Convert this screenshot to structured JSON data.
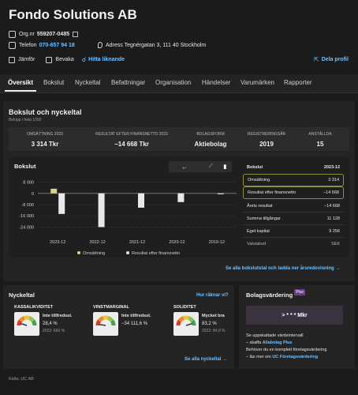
{
  "company": {
    "name": "Fondo Solutions AB",
    "org_label": "Org.nr",
    "org_nr": "559207-0485",
    "phone_label": "Telefon",
    "phone": "070-657 94 18",
    "address": "Adress Tegnérgatan 3, 111 40 Stockholm"
  },
  "actions": {
    "compare": "Jämför",
    "watch": "Bevaka",
    "similar": "Hitta liknande",
    "share": "Dela profil"
  },
  "tabs": [
    "Översikt",
    "Bokslut",
    "Nyckeltal",
    "Befattningar",
    "Organisation",
    "Händelser",
    "Varumärken",
    "Rapporter"
  ],
  "overview": {
    "title": "Bokslut och nyckeltal",
    "subtitle": "Belopp i hela 1000",
    "kpis": [
      {
        "label": "Omsättning 2023",
        "value": "3 314 Tkr"
      },
      {
        "label": "Resultat efter finansnetto 2023",
        "value": "−14 668 Tkr"
      },
      {
        "label": "Bolagsform",
        "value": "Aktiebolag"
      },
      {
        "label": "Registreringsår",
        "value": "2019"
      },
      {
        "label": "Anställda",
        "value": "15"
      }
    ]
  },
  "bokslut": {
    "title": "Bokslut",
    "table_header": "Bokslut",
    "table_year": "2023-12",
    "rows": [
      {
        "label": "Omsättning",
        "value": "3 314"
      },
      {
        "label": "Resultat efter finansnetto",
        "value": "−14 668"
      },
      {
        "label": "Årets resultat",
        "value": "−14 668"
      },
      {
        "label": "Summa tillgångar",
        "value": "11 128"
      },
      {
        "label": "Eget kapital",
        "value": "9 256"
      },
      {
        "label": "Valutakod",
        "value": "SEK"
      }
    ],
    "see_all": "Se alla bokslutstal och ladda ner årsredovisning →"
  },
  "chart_data": {
    "type": "bar",
    "categories": [
      "2023-12",
      "2022-12",
      "2021-12",
      "2020-12",
      "2019-12"
    ],
    "series": [
      {
        "name": "Omsättning",
        "color": "#d4d48c",
        "values": [
          3314,
          0,
          0,
          0,
          0
        ]
      },
      {
        "name": "Resultat efter finansnetto",
        "color": "#e8e8e8",
        "values": [
          -14668,
          -24000,
          -10200,
          -6200,
          -600
        ]
      }
    ],
    "yticks": [
      "8 000",
      "0",
      "-8 000",
      "-16 000",
      "-24 000"
    ],
    "ylim": [
      -26000,
      10000
    ],
    "legend": "bottom"
  },
  "nyckeltal": {
    "title": "Nyckeltal",
    "how_link": "Hur räknar vi?",
    "cards": [
      {
        "title": "Kassalikviditet",
        "desc": "Inte tillfredsst.",
        "value": "28,4 %",
        "prev": "2022: 660 %",
        "level": 0.1
      },
      {
        "title": "Vinstmarginal",
        "desc": "Inte tillfredsst.",
        "value": "−34 111,6 %",
        "prev": "",
        "level": 0.05
      },
      {
        "title": "Soliditet",
        "desc": "Mycket bra",
        "value": "83,2 %",
        "prev": "2022: 84,9 %",
        "level": 0.9
      }
    ],
    "see_all": "Se alla nyckeltal →"
  },
  "valuation": {
    "title": "Bolagsvärdering",
    "badge": "Plus",
    "button": "> * * * Mkr",
    "text1": "Se uppskattade värdeintervall",
    "text2": "– skaffa",
    "text2_link": "Allabolag Plus",
    "text3": "Behöver du en komplett företagsvärdering",
    "text4": "– läs mer om",
    "text4_link": "UC Företagsvärdering"
  },
  "source": "Källa: UC AB"
}
